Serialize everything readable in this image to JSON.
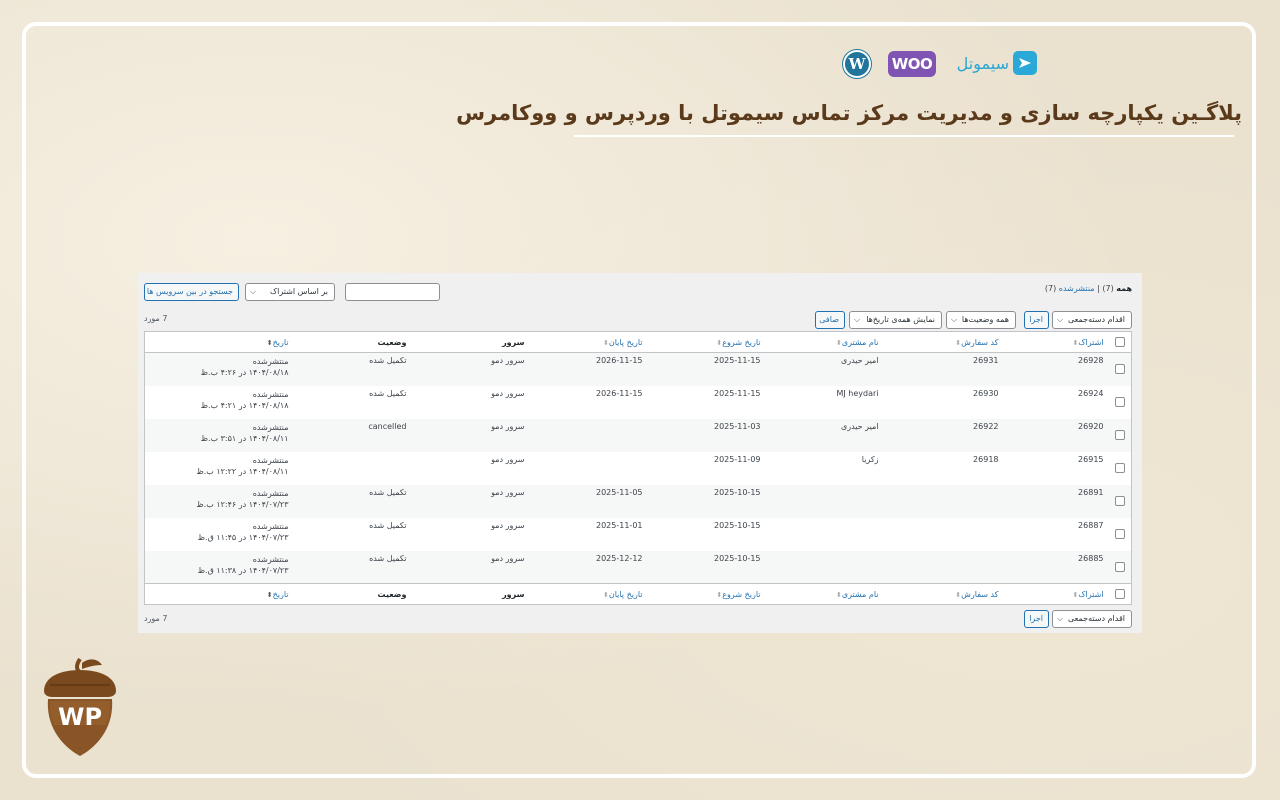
{
  "brand": {
    "wp_logo_letter": "W",
    "woo_logo_text": "WOO",
    "simotel_text": "سیموتل",
    "headline": "پلاگـین یکپارچه سازی و مدیریت مرکز تماس سیموتل با وردپرس و ووکامرس",
    "corner_logo_text": "WP",
    "colors": {
      "wp": "#21759b",
      "woo": "#7f54b3",
      "simotel": "#2aa9d8",
      "headline": "#5a3a1a",
      "acorn": "#7a4a1e"
    }
  },
  "filters": {
    "all_label": "همه",
    "all_count": "(7)",
    "separator": "|",
    "published_label": "منتشرشده",
    "published_count": "(7)",
    "search_value": "",
    "search_by_select": "بر اساس اشتراک",
    "search_button": "جستجو در بین سرویس ها",
    "bulk_action_select": "اقدام دسته‌جمعی",
    "apply_button": "اجرا",
    "status_select": "همه وضعیت‌ها",
    "dates_select": "نمایش همه‌ی تاریخ‌ها",
    "filter_button": "صافی",
    "items_count": "7 مورد"
  },
  "table": {
    "columns": {
      "subscription": "اشتراک",
      "order_code": "کد سفارش",
      "customer_name": "نام مشتری",
      "start_date": "تاریخ شروع",
      "end_date": "تاریخ پایان",
      "server": "سرور",
      "status": "وضعیت",
      "date": "تاریخ"
    },
    "rows": [
      {
        "subscription": "26928",
        "order_code": "26931",
        "customer": "امیر حیدری",
        "start": "2025-11-15",
        "end": "2026-11-15",
        "server": "سرور دمو",
        "status": "تکمیل شده",
        "pub": "منتشرشده",
        "date": "۱۴۰۴/۰۸/۱۸ در ۴:۲۶ ب.ظ"
      },
      {
        "subscription": "26924",
        "order_code": "26930",
        "customer": "MJ heydari",
        "start": "2025-11-15",
        "end": "2026-11-15",
        "server": "سرور دمو",
        "status": "تکمیل شده",
        "pub": "منتشرشده",
        "date": "۱۴۰۴/۰۸/۱۸ در ۴:۲۱ ب.ظ"
      },
      {
        "subscription": "26920",
        "order_code": "26922",
        "customer": "امیر حیدری",
        "start": "2025-11-03",
        "end": "",
        "server": "سرور دمو",
        "status": "cancelled",
        "pub": "منتشرشده",
        "date": "۱۴۰۴/۰۸/۱۱ در ۳:۵۱ ب.ظ"
      },
      {
        "subscription": "26915",
        "order_code": "26918",
        "customer": "زکریا",
        "start": "2025-11-09",
        "end": "",
        "server": "سرور دمو",
        "status": "",
        "pub": "منتشرشده",
        "date": "۱۴۰۴/۰۸/۱۱ در ۱۲:۲۲ ب.ظ"
      },
      {
        "subscription": "26891",
        "order_code": "",
        "customer": "",
        "start": "2025-10-15",
        "end": "2025-11-05",
        "server": "سرور دمو",
        "status": "تکمیل شده",
        "pub": "منتشرشده",
        "date": "۱۴۰۴/۰۷/۲۳ در ۱۲:۴۶ ب.ظ"
      },
      {
        "subscription": "26887",
        "order_code": "",
        "customer": "",
        "start": "2025-10-15",
        "end": "2025-11-01",
        "server": "سرور دمو",
        "status": "تکمیل شده",
        "pub": "منتشرشده",
        "date": "۱۴۰۴/۰۷/۲۳ در ۱۱:۴۵ ق.ظ"
      },
      {
        "subscription": "26885",
        "order_code": "",
        "customer": "",
        "start": "2025-10-15",
        "end": "2025-12-12",
        "server": "سرور دمو",
        "status": "تکمیل شده",
        "pub": "منتشرشده",
        "date": "۱۴۰۴/۰۷/۲۳ در ۱۱:۳۸ ق.ظ"
      }
    ]
  }
}
